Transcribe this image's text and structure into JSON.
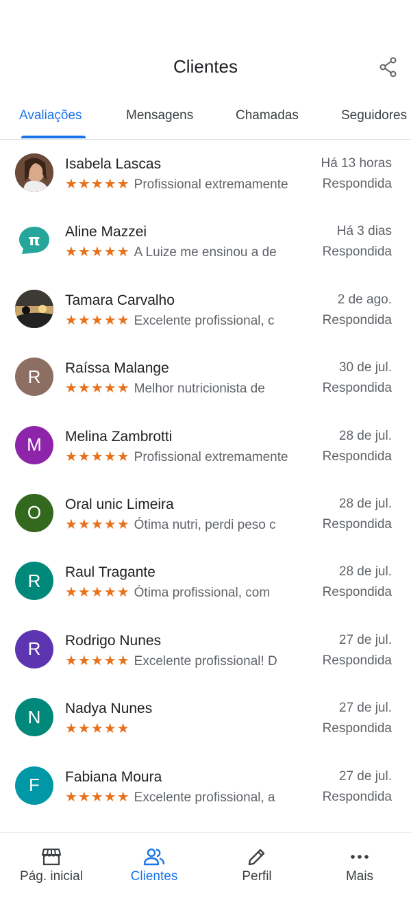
{
  "header": {
    "title": "Clientes",
    "share_icon": "share-icon"
  },
  "tabs": [
    {
      "label": "Avaliações",
      "active": true
    },
    {
      "label": "Mensagens",
      "active": false
    },
    {
      "label": "Chamadas",
      "active": false
    },
    {
      "label": "Seguidores",
      "active": false
    }
  ],
  "reviews": [
    {
      "name": "Isabela Lascas",
      "stars": "★★★★★",
      "snippet": "Profissional extremamente",
      "date": "Há 13 horas",
      "status": "Respondida",
      "avatar": {
        "type": "photo",
        "initial": "",
        "color": "#6b4a3a"
      }
    },
    {
      "name": "Aline Mazzei",
      "stars": "★★★★★",
      "snippet": "A Luize me ensinou a de",
      "date": "Há 3 dias",
      "status": "Respondida",
      "avatar": {
        "type": "logo",
        "initial": "π",
        "color": "#26a69a"
      }
    },
    {
      "name": "Tamara Carvalho",
      "stars": "★★★★★",
      "snippet": "Excelente profissional, c",
      "date": "2 de ago.",
      "status": "Respondida",
      "avatar": {
        "type": "photo",
        "initial": "",
        "color": "#3d3a36"
      }
    },
    {
      "name": "Raíssa Malange",
      "stars": "★★★★★",
      "snippet": "Melhor nutricionista de",
      "date": "30 de jul.",
      "status": "Respondida",
      "avatar": {
        "type": "initial",
        "initial": "R",
        "color": "#8d6e63"
      }
    },
    {
      "name": "Melina Zambrotti",
      "stars": "★★★★★",
      "snippet": "Profissional extremamente",
      "date": "28 de jul.",
      "status": "Respondida",
      "avatar": {
        "type": "initial",
        "initial": "M",
        "color": "#8e24aa"
      }
    },
    {
      "name": "Oral unic Limeira",
      "stars": "★★★★★",
      "snippet": "Ótima nutri, perdi peso c",
      "date": "28 de jul.",
      "status": "Respondida",
      "avatar": {
        "type": "initial",
        "initial": "O",
        "color": "#33691e"
      }
    },
    {
      "name": "Raul Tragante",
      "stars": "★★★★★",
      "snippet": "Ótima profissional,  com",
      "date": "28 de jul.",
      "status": "Respondida",
      "avatar": {
        "type": "initial",
        "initial": "R",
        "color": "#00897b"
      }
    },
    {
      "name": "Rodrigo Nunes",
      "stars": "★★★★★",
      "snippet": "Excelente profissional! D",
      "date": "27 de jul.",
      "status": "Respondida",
      "avatar": {
        "type": "initial",
        "initial": "R",
        "color": "#5e35b1"
      }
    },
    {
      "name": "Nadya Nunes",
      "stars": "★★★★★",
      "snippet": "",
      "date": "27 de jul.",
      "status": "Respondida",
      "avatar": {
        "type": "initial",
        "initial": "N",
        "color": "#00897b"
      }
    },
    {
      "name": "Fabiana Moura",
      "stars": "★★★★★",
      "snippet": "Excelente profissional, a",
      "date": "27 de jul.",
      "status": "Respondida",
      "avatar": {
        "type": "initial",
        "initial": "F",
        "color": "#0097a7"
      }
    }
  ],
  "bottom_nav": [
    {
      "label": "Pág. inicial",
      "icon": "storefront-icon",
      "active": false
    },
    {
      "label": "Clientes",
      "icon": "people-icon",
      "active": true
    },
    {
      "label": "Perfil",
      "icon": "pencil-icon",
      "active": false
    },
    {
      "label": "Mais",
      "icon": "more-dots-icon",
      "active": false
    }
  ],
  "colors": {
    "accent": "#1a73e8",
    "star": "#e8711a",
    "secondary_text": "#5f6368"
  }
}
